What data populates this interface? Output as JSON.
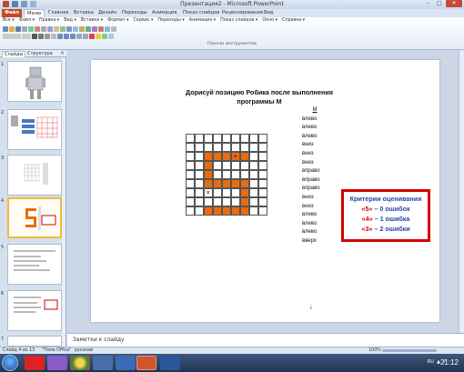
{
  "window": {
    "title": "Презентация2 - Microsoft PowerPoint",
    "controls": {
      "minimize": "–",
      "maximize": "□",
      "close": "✕"
    }
  },
  "menu": {
    "tabs": [
      "Файл",
      "Меню",
      "Главная",
      "Вставка",
      "Дизайн",
      "Переходы",
      "Анимация",
      "Показ слайдов",
      "Рецензирование",
      "Вид"
    ]
  },
  "ribbon": {
    "submenu": [
      "Все ▾",
      "Файл ▾",
      "Правка ▾",
      "Вид ▾",
      "Вставка ▾",
      "Формат ▾",
      "Сервис ▾",
      "Переходы ▾",
      "Анимация ▾",
      "Показ слайдов ▾",
      "Окно ▾",
      "Справка ▾"
    ],
    "group_label": "Панели инструментов"
  },
  "left_panel": {
    "tabs": [
      "Слайды",
      "Структура"
    ],
    "close": "×",
    "slide_numbers": [
      "1",
      "2",
      "3",
      "4",
      "5",
      "6",
      "7"
    ],
    "selected_index": 3
  },
  "slide": {
    "title": "Дорисуй позицию Робика после выполнения программы М",
    "commands_header": "М",
    "commands": [
      "влево",
      "влево",
      "влево",
      "вниз",
      "вниз",
      "вниз",
      "вправо",
      "вправо",
      "вправо",
      "вниз",
      "вниз",
      "влево",
      "влево",
      "влево",
      "вверх"
    ],
    "grid_marks": [
      "x",
      "x"
    ],
    "criteria": {
      "title": "Критерии оценивания",
      "lines": [
        {
          "num": "«5»",
          "text": " – 0 ошибок"
        },
        {
          "num": "«4»",
          "text": " – 1 ошибка"
        },
        {
          "num": "«3»",
          "text": " – 2 ошибки"
        }
      ]
    }
  },
  "notes": {
    "placeholder": "Заметки к слайду"
  },
  "status": {
    "slide_info": "Слайд 4 из 13",
    "theme": "\"Тема Office\"",
    "language": "русский",
    "zoom": "100%"
  },
  "taskbar": {
    "clock": "21:12",
    "tray_lang": "RU"
  },
  "colors": {
    "accent": "#c5472a",
    "orange_fill": "#e86c11",
    "criteria_border": "#d40000",
    "criteria_text": "#2a45a8"
  }
}
